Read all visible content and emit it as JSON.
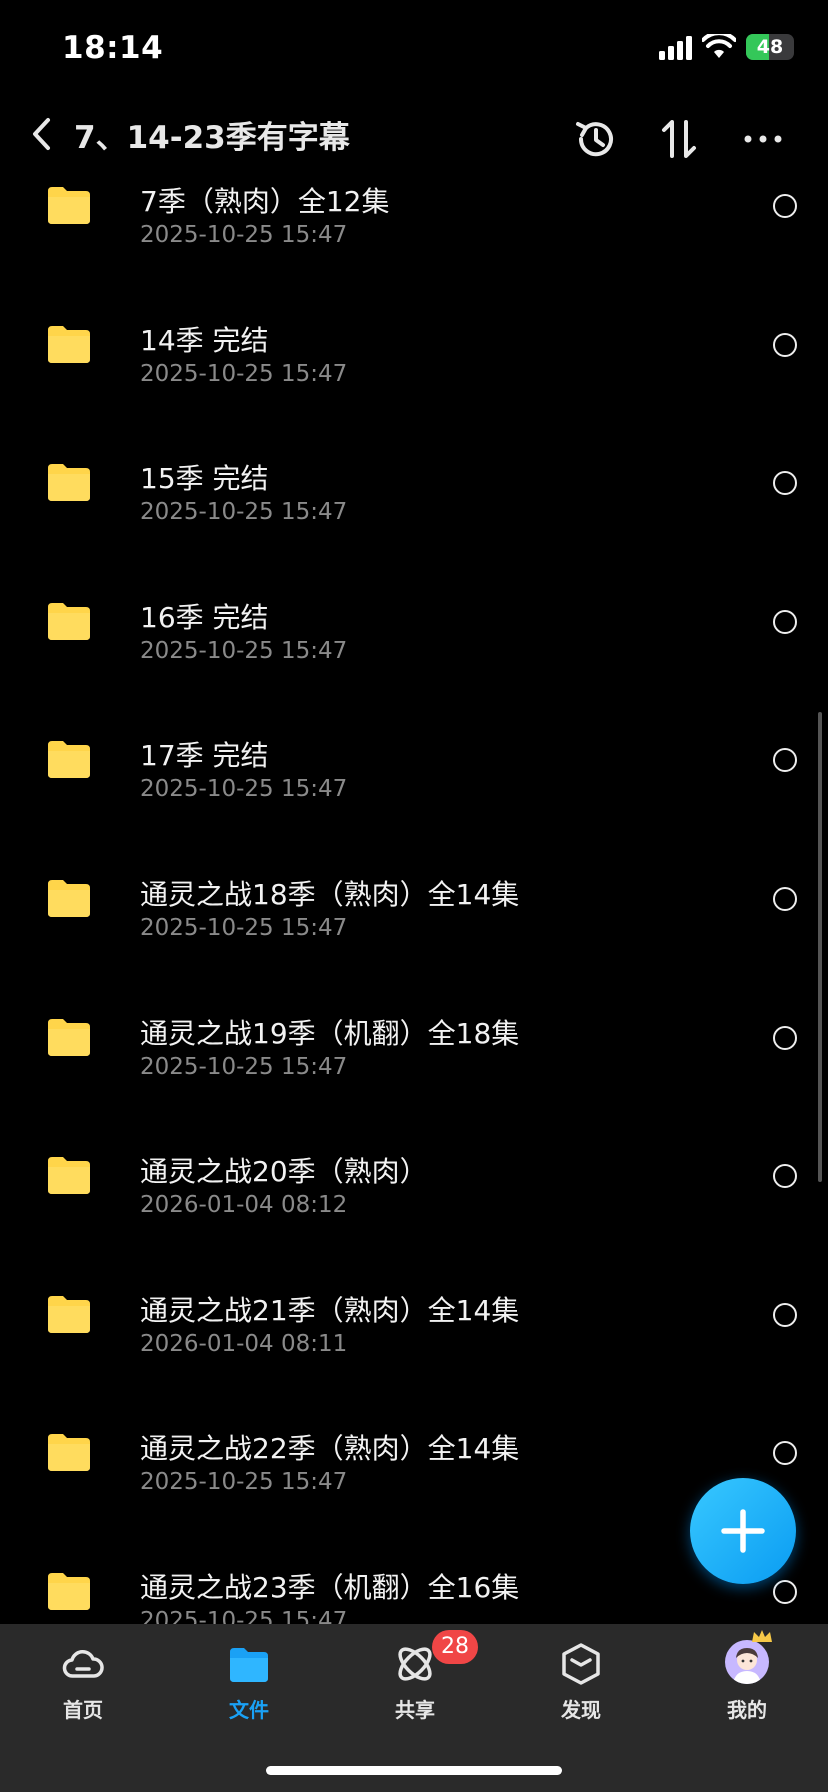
{
  "status_bar": {
    "time": "18:14",
    "battery": "48",
    "battery_level_percent": 48
  },
  "header": {
    "title": "7、14-23季有字幕"
  },
  "files": [
    {
      "name": "7季（熟肉）全12集",
      "date": "2025-10-25 15:47"
    },
    {
      "name": "14季 完结",
      "date": "2025-10-25 15:47"
    },
    {
      "name": "15季 完结",
      "date": "2025-10-25 15:47"
    },
    {
      "name": "16季 完结",
      "date": "2025-10-25 15:47"
    },
    {
      "name": "17季 完结",
      "date": "2025-10-25 15:47"
    },
    {
      "name": "通灵之战18季（熟肉）全14集",
      "date": "2025-10-25 15:47"
    },
    {
      "name": "通灵之战19季（机翻）全18集",
      "date": "2025-10-25 15:47"
    },
    {
      "name": "通灵之战20季（熟肉）",
      "date": "2026-01-04 08:12"
    },
    {
      "name": "通灵之战21季（熟肉）全14集",
      "date": "2026-01-04 08:11"
    },
    {
      "name": "通灵之战22季（熟肉）全14集",
      "date": "2025-10-25 15:47"
    },
    {
      "name": "通灵之战23季（机翻）全16集",
      "date": "2025-10-25 15:47"
    }
  ],
  "tab_bar": {
    "home": "首页",
    "files": "文件",
    "share": "共享",
    "share_badge": "28",
    "discover": "发现",
    "mine": "我的"
  },
  "colors": {
    "accent": "#1aa1f5",
    "folder": "#ffd54a",
    "badge": "#f04646"
  }
}
